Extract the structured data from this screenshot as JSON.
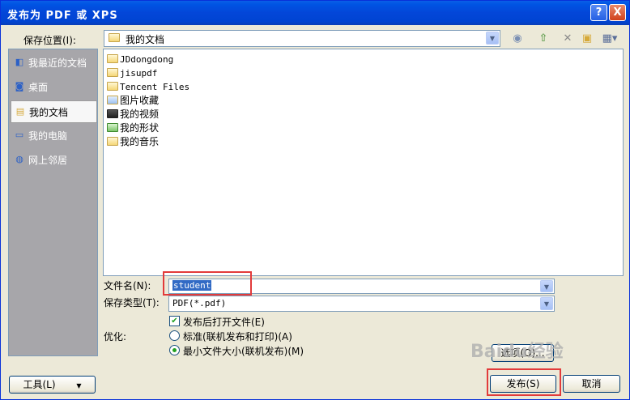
{
  "window": {
    "title": "发布为 PDF 或 XPS",
    "help_glyph": "?",
    "close_glyph": "X"
  },
  "save_location": {
    "label": "保存位置(I):",
    "value": "我的文档"
  },
  "places": [
    {
      "label": "我最近的文档",
      "icon": "recent-documents-icon"
    },
    {
      "label": "桌面",
      "icon": "desktop-icon"
    },
    {
      "label": "我的文档",
      "icon": "my-documents-icon",
      "active": true
    },
    {
      "label": "我的电脑",
      "icon": "my-computer-icon"
    },
    {
      "label": "网上邻居",
      "icon": "network-places-icon"
    }
  ],
  "files": [
    {
      "name": "JDdongdong",
      "icon": "folder-icon"
    },
    {
      "name": "jisupdf",
      "icon": "folder-icon"
    },
    {
      "name": "Tencent Files",
      "icon": "folder-icon"
    },
    {
      "name": "图片收藏",
      "icon": "pictures-folder-icon"
    },
    {
      "name": "我的视频",
      "icon": "videos-folder-icon"
    },
    {
      "name": "我的形状",
      "icon": "shapes-folder-icon"
    },
    {
      "name": "我的音乐",
      "icon": "music-folder-icon"
    }
  ],
  "filename": {
    "label": "文件名(N):",
    "value": "student"
  },
  "filetype": {
    "label": "保存类型(T):",
    "value": "PDF(*.pdf)"
  },
  "open_after_publish": {
    "label": "发布后打开文件(E)",
    "checked": true
  },
  "optimize": {
    "label": "优化:",
    "options": [
      {
        "label": "标准(联机发布和打印)(A)",
        "selected": false
      },
      {
        "label": "最小文件大小(联机发布)(M)",
        "selected": true
      }
    ]
  },
  "buttons": {
    "options": "选项(O)...",
    "tools": "工具(L)",
    "publish": "发布(S)",
    "cancel": "取消"
  },
  "watermark": "Baidu经验",
  "colors": {
    "titlebar": "#0054e3",
    "highlight_box": "#e23b3b"
  }
}
